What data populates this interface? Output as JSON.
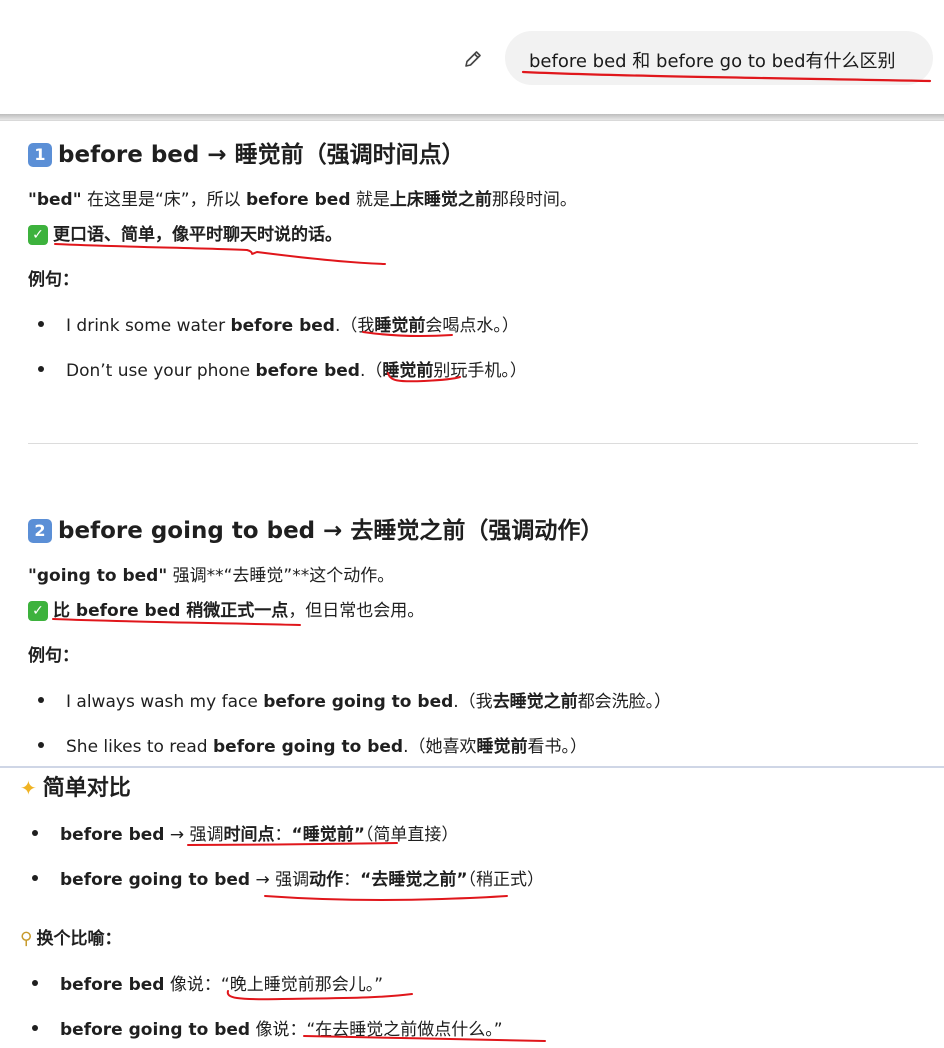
{
  "header": {
    "edit_icon": "pencil-icon",
    "user_message": "before bed 和 before go to bed有什么区别"
  },
  "section1": {
    "number": "1",
    "title": "before bed → 睡觉前（强调时间点）",
    "desc_a": "\"bed\"",
    "desc_b": " 在这里是“床”，所以 ",
    "desc_c": "before bed",
    "desc_d": " 就是",
    "desc_e": "上床睡觉之前",
    "desc_f": "那段时间。",
    "note": "更口语、简单，像平时聊天时说的话。",
    "examples_label": "例句：",
    "ex1_a": "I drink some water ",
    "ex1_b": "before bed",
    "ex1_c": ".（我",
    "ex1_d": "睡觉前",
    "ex1_e": "会喝点水。）",
    "ex2_a": "Don’t use your phone ",
    "ex2_b": "before bed",
    "ex2_c": ".（",
    "ex2_d": "睡觉前",
    "ex2_e": "别玩手机。）"
  },
  "section2": {
    "number": "2",
    "title": "before going to bed → 去睡觉之前（强调动作）",
    "desc_a": "\"going to bed\"",
    "desc_b": " 强调**“去睡觉”**这个动作。",
    "note_a": "比 before bed 稍微正式一点",
    "note_b": "，但日常也会用。",
    "examples_label": "例句：",
    "ex1_a": "I always wash my face ",
    "ex1_b": "before going to bed",
    "ex1_c": ".（我",
    "ex1_d": "去睡觉之前",
    "ex1_e": "都会洗脸。）",
    "ex2_a": "She likes to read ",
    "ex2_b": "before going to bed",
    "ex2_c": ".（她喜欢",
    "ex2_d": "睡觉前",
    "ex2_e": "看书。）"
  },
  "section3": {
    "title": "简单对比",
    "cmp1_a": "before bed",
    "cmp1_b": " → 强调",
    "cmp1_c": "时间点",
    "cmp1_d": "：",
    "cmp1_e": "“睡觉前”",
    "cmp1_f": "（简单直接）",
    "cmp2_a": "before going to bed",
    "cmp2_b": " → 强调",
    "cmp2_c": "动作",
    "cmp2_d": "：",
    "cmp2_e": "“去睡觉之前”",
    "cmp2_f": "（稍正式）",
    "metaphor_label": "换个比喻：",
    "m1_a": "before bed",
    "m1_b": " 像说：“晚上睡觉前那会儿。”",
    "m2_a": "before going to bed",
    "m2_b": " 像说：“在去睡觉之前做点什么。”"
  },
  "colors": {
    "annotation": "#e0161b",
    "bubble": "#f2f2f2"
  }
}
